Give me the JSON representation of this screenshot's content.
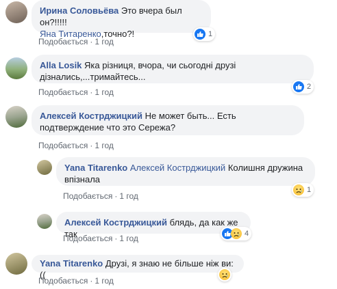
{
  "comments": [
    {
      "author": "Ирина Соловьёва",
      "text": "Это вчера был он?!!!!!",
      "mention": "Яна Титаренко",
      "text2": ",точно?!",
      "like_label": "Подобається",
      "time": "1 год",
      "reactions": [
        "like-icon"
      ],
      "reaction_count": "1"
    },
    {
      "author": "Alla Losik",
      "text": "Яка різниця, вчора, чи сьогодні друзі дізнались,...тримайтесь...",
      "like_label": "Подобається",
      "time": "1 год",
      "reactions": [
        "like-icon"
      ],
      "reaction_count": "2"
    },
    {
      "author": "Алексей Кострджицкий",
      "text": "Не может быть... Есть подтверждение что это Сережа?",
      "like_label": "Подобається",
      "time": "1 год"
    }
  ],
  "replies": [
    {
      "author": "Yana Titarenko",
      "mention": "Алексей Кострджицкий",
      "text": "Колишня дружина впізнала",
      "like_label": "Подобається",
      "time": "1 год",
      "reactions": [
        "sad-icon"
      ],
      "reaction_count": "1"
    },
    {
      "author": "Алексей Кострджицкий",
      "text": "блядь, да как же так",
      "like_label": "Подобається",
      "time": "1 год",
      "reactions": [
        "like-icon",
        "sad-icon"
      ],
      "reaction_count": "4"
    }
  ],
  "last_comment": {
    "author": "Yana Titarenko",
    "text": "Друзі, я знаю не більше ніж ви:((",
    "like_label": "Подобається",
    "time": "1 год",
    "reactions": [
      "sad-icon"
    ]
  },
  "separator": "·",
  "colors": {
    "author_link": "#385898",
    "bubble_bg": "#f2f3f5",
    "meta_text": "#606770",
    "like_blue": "#1877f2",
    "sad_yellow": "#f7b928"
  }
}
